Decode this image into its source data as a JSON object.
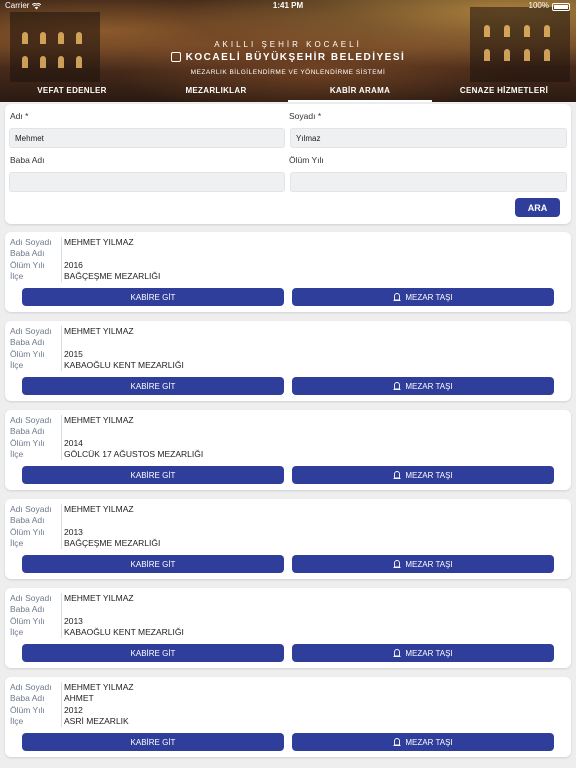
{
  "status_bar": {
    "carrier": "Carrier",
    "time": "1:41 PM",
    "battery": "100%"
  },
  "header": {
    "brand_top": "AKILLI ŞEHİR KOCAELİ",
    "brand_main": "KOCAELİ BÜYÜKŞEHİR BELEDİYESİ",
    "brand_sub": "MEZARLIK BİLGİLENDİRME VE YÖNLENDİRME SİSTEMİ"
  },
  "tabs": [
    {
      "label": "VEFAT EDENLER",
      "active": false
    },
    {
      "label": "MEZARLIKLAR",
      "active": false
    },
    {
      "label": "KABİR ARAMA",
      "active": true
    },
    {
      "label": "CENAZE HİZMETLERİ",
      "active": false
    }
  ],
  "search_form": {
    "first_name_label": "Adı *",
    "first_name_value": "Mehmet",
    "last_name_label": "Soyadı *",
    "last_name_value": "Yılmaz",
    "father_name_label": "Baba Adı",
    "father_name_value": "",
    "death_year_label": "Ölüm Yılı",
    "death_year_value": "",
    "search_button": "ARA"
  },
  "result_labels": {
    "full_name": "Adı Soyadı",
    "father_name": "Baba Adı",
    "death_year": "Ölüm Yılı",
    "district": "İlçe",
    "go_button": "KABİRE GİT",
    "stone_button": "MEZAR TAŞI"
  },
  "results": [
    {
      "full_name": "MEHMET YILMAZ",
      "father_name": "",
      "death_year": "2016",
      "district": "BAĞÇEŞME MEZARLIĞI"
    },
    {
      "full_name": "MEHMET YILMAZ",
      "father_name": "",
      "death_year": "2015",
      "district": "KABAOĞLU KENT MEZARLIĞI"
    },
    {
      "full_name": "MEHMET YILMAZ",
      "father_name": "",
      "death_year": "2014",
      "district": "GÖLCÜK 17 AĞUSTOS MEZARLIĞI"
    },
    {
      "full_name": "MEHMET YILMAZ",
      "father_name": "",
      "death_year": "2013",
      "district": "BAĞÇEŞME MEZARLIĞI"
    },
    {
      "full_name": "MEHMET YILMAZ",
      "father_name": "",
      "death_year": "2013",
      "district": "KABAOĞLU KENT MEZARLIĞI"
    },
    {
      "full_name": "MEHMET YILMAZ",
      "father_name": "AHMET",
      "death_year": "2012",
      "district": "ASRİ  MEZARLIK"
    }
  ],
  "colors": {
    "accent": "#2f3d9b",
    "label": "#6c7a8c",
    "background": "#eeeeee"
  }
}
